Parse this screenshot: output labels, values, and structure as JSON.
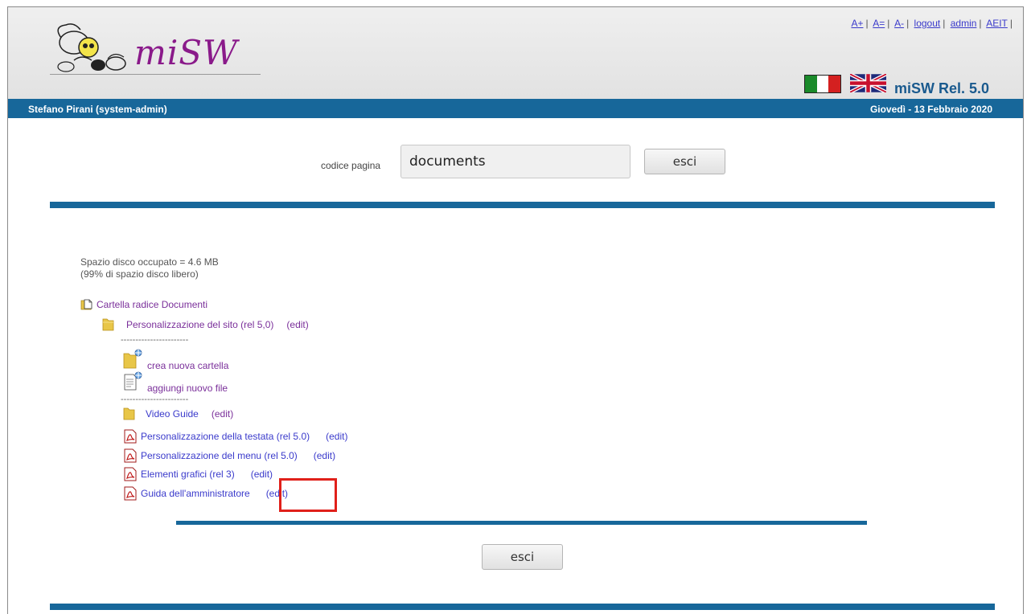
{
  "header": {
    "logo_text": "miSW",
    "top_links": [
      {
        "label": "A+"
      },
      {
        "label": "A="
      },
      {
        "label": "A-"
      },
      {
        "label": "logout"
      },
      {
        "label": "admin"
      },
      {
        "label": "AEIT"
      }
    ],
    "release": "miSW Rel. 5.0",
    "flag_it_colors": [
      "#1a8a2a",
      "#ffffff",
      "#d42020"
    ]
  },
  "userbar": {
    "user": "Stefano Pirani (system-admin)",
    "date": "Giovedì - 13 Febbraio 2020"
  },
  "page_code": {
    "label": "codice pagina",
    "value": "documents",
    "exit_label": "esci"
  },
  "disk": {
    "used": "Spazio disco occupato = 4.6 MB",
    "free": "(99% di spazio disco libero)"
  },
  "tree": {
    "root_label": "Cartella radice Documenti",
    "folder_label": "Personalizzazione del sito (rel 5,0)",
    "folder_edit": "(edit)",
    "separator": "-----------------------",
    "new_folder": "crea nuova cartella",
    "new_file": "aggiungi nuovo file",
    "items": [
      {
        "label": "Video Guide",
        "edit": "(edit)",
        "icon": "folder-icon"
      },
      {
        "label": "Personalizzazione della testata (rel 5.0)",
        "edit": "(edit)",
        "icon": "pdf-icon"
      },
      {
        "label": "Personalizzazione del menu (rel 5.0)",
        "edit": "(edit)",
        "icon": "pdf-icon"
      },
      {
        "label": "Elementi grafici (rel 3)",
        "edit": "(edit)",
        "icon": "pdf-icon"
      },
      {
        "label": "Guida dell'amministratore",
        "edit": "(edit)",
        "icon": "pdf-icon"
      }
    ]
  },
  "footer": {
    "exit_label": "esci"
  },
  "colors": {
    "accent": "#17679a",
    "link": "#3a3acb",
    "visited": "#7a2f9a",
    "highlight": "#e0201a"
  }
}
